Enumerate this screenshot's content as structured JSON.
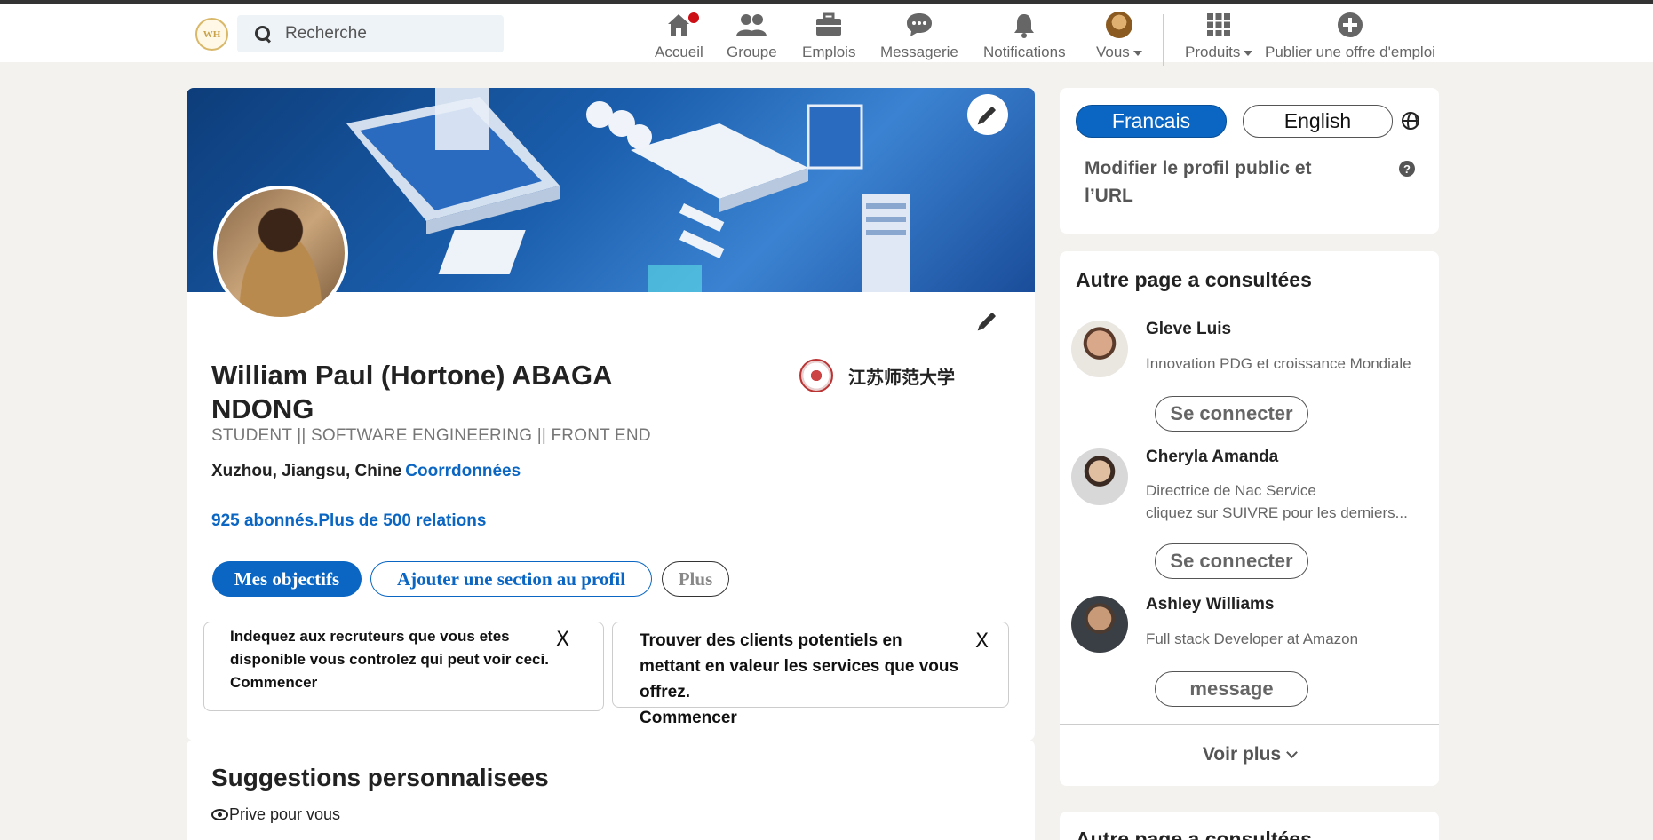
{
  "nav": {
    "logo_text": "WH",
    "search_placeholder": "Recherche",
    "items": [
      {
        "label": "Accueil",
        "icon": "home-icon"
      },
      {
        "label": "Groupe",
        "icon": "group-icon"
      },
      {
        "label": "Emplois",
        "icon": "briefcase-icon"
      },
      {
        "label": "Messagerie",
        "icon": "chat-icon"
      },
      {
        "label": "Notifications",
        "icon": "bell-icon"
      },
      {
        "label": "Vous",
        "icon": "avatar"
      },
      {
        "label": "Produits",
        "icon": "grid-icon"
      },
      {
        "label": "Publier une offre d'emploi",
        "icon": "plus-circle-icon"
      }
    ],
    "accent": "#0a66c2",
    "badge_color": "#cc1016"
  },
  "profile": {
    "name": "William Paul (Hortone) ABAGA NDONG",
    "headline": "STUDENT || SOFTWARE ENGINEERING || FRONT END",
    "location": "Xuzhou, Jiangsu, Chine",
    "contact_link": "Coorrdonnées",
    "followers": "925 abonnés.Plus de 500 relations",
    "university": "江苏师范大学",
    "buttons": {
      "primary": "Mes objectifs",
      "add_section": "Ajouter une section au profil",
      "more": "Plus"
    },
    "tips": [
      {
        "text": "Indequez aux recruteurs que vous etes disponible vous controlez qui peut voir ceci.",
        "cta": "Commencer",
        "close": "X"
      },
      {
        "text": "Trouver des clients potentiels en mettant en valeur les services que vous offrez.",
        "cta": "Commencer",
        "close": "X"
      }
    ]
  },
  "suggestions": {
    "title": "Suggestions personnalisees",
    "subtitle": "Prive pour vous"
  },
  "sidebar": {
    "languages": {
      "active": "Francais",
      "other": "English"
    },
    "edit_public_profile": "Modifier le profil public et l’URL",
    "help": "?",
    "people_title": "Autre page a consultées",
    "people": [
      {
        "name": "Gleve Luis",
        "desc": [
          "Innovation PDG et croissance Mondiale"
        ],
        "action": "Se connecter"
      },
      {
        "name": "Cheryla Amanda",
        "desc": [
          "Directrice de Nac Service",
          "cliquez sur SUIVRE pour les derniers..."
        ],
        "action": "Se connecter"
      },
      {
        "name": "Ashley Williams",
        "desc": [
          "Full stack Developer at Amazon"
        ],
        "action": "message"
      }
    ],
    "see_more": "Voir plus",
    "second_title": "Autre page a consultées"
  }
}
